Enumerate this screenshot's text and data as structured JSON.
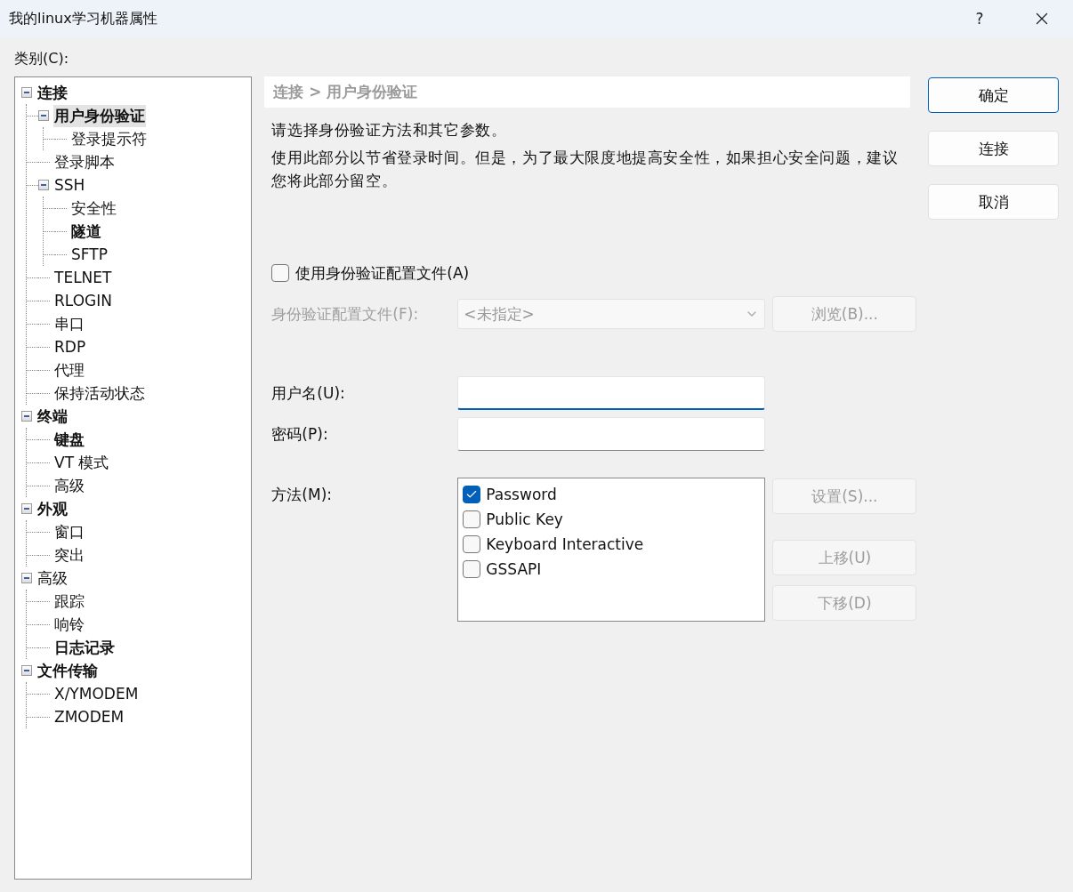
{
  "window": {
    "title": "我的linux学习机器属性",
    "help": "?"
  },
  "category_label": "类别(C):",
  "tree": [
    {
      "label": "连接",
      "bold": true,
      "selected": false,
      "expanded": true,
      "children": [
        {
          "label": "用户身份验证",
          "bold": true,
          "selected": true,
          "expanded": true,
          "children": [
            {
              "label": "登录提示符",
              "bold": false,
              "selected": false
            }
          ]
        },
        {
          "label": "登录脚本",
          "bold": false,
          "selected": false
        },
        {
          "label": "SSH",
          "bold": false,
          "selected": false,
          "expanded": true,
          "children": [
            {
              "label": "安全性",
              "bold": false,
              "selected": false
            },
            {
              "label": "隧道",
              "bold": true,
              "selected": false
            },
            {
              "label": "SFTP",
              "bold": false,
              "selected": false
            }
          ]
        },
        {
          "label": "TELNET",
          "bold": false,
          "selected": false
        },
        {
          "label": "RLOGIN",
          "bold": false,
          "selected": false
        },
        {
          "label": "串口",
          "bold": false,
          "selected": false
        },
        {
          "label": "RDP",
          "bold": false,
          "selected": false
        },
        {
          "label": "代理",
          "bold": false,
          "selected": false
        },
        {
          "label": "保持活动状态",
          "bold": false,
          "selected": false
        }
      ]
    },
    {
      "label": "终端",
      "bold": true,
      "selected": false,
      "expanded": true,
      "children": [
        {
          "label": "键盘",
          "bold": true,
          "selected": false
        },
        {
          "label": "VT 模式",
          "bold": false,
          "selected": false
        },
        {
          "label": "高级",
          "bold": false,
          "selected": false
        }
      ]
    },
    {
      "label": "外观",
      "bold": true,
      "selected": false,
      "expanded": true,
      "children": [
        {
          "label": "窗口",
          "bold": false,
          "selected": false
        },
        {
          "label": "突出",
          "bold": false,
          "selected": false
        }
      ]
    },
    {
      "label": "高级",
      "bold": false,
      "selected": false,
      "expanded": true,
      "children": [
        {
          "label": "跟踪",
          "bold": false,
          "selected": false
        },
        {
          "label": "响铃",
          "bold": false,
          "selected": false
        },
        {
          "label": "日志记录",
          "bold": true,
          "selected": false
        }
      ]
    },
    {
      "label": "文件传输",
      "bold": true,
      "selected": false,
      "expanded": true,
      "children": [
        {
          "label": "X/YMODEM",
          "bold": false,
          "selected": false
        },
        {
          "label": "ZMODEM",
          "bold": false,
          "selected": false
        }
      ]
    }
  ],
  "breadcrumb": "连接 > 用户身份验证",
  "descriptions": [
    "请选择身份验证方法和其它参数。",
    "使用此部分以节省登录时间。但是，为了最大限度地提高安全性，如果担心安全问题，建议您将此部分留空。"
  ],
  "use_profile": {
    "label": "使用身份验证配置文件(A)",
    "checked": false
  },
  "profile": {
    "label": "身份验证配置文件(F):",
    "value": "<未指定>",
    "disabled": true,
    "browse": "浏览(B)..."
  },
  "username": {
    "label": "用户名(U):",
    "focused": true
  },
  "password": {
    "label": "密码(P):",
    "focused": false
  },
  "method": {
    "label": "方法(M):",
    "items": [
      {
        "label": "Password",
        "checked": true
      },
      {
        "label": "Public Key",
        "checked": false
      },
      {
        "label": "Keyboard Interactive",
        "checked": false
      },
      {
        "label": "GSSAPI",
        "checked": false
      }
    ],
    "buttons": [
      {
        "label": "设置(S)...",
        "disabled": true
      },
      {
        "label": "上移(U)",
        "disabled": true
      },
      {
        "label": "下移(D)",
        "disabled": true
      }
    ]
  },
  "dialog_buttons": [
    {
      "label": "确定",
      "default": true
    },
    {
      "label": "连接",
      "default": false
    },
    {
      "label": "取消",
      "default": false
    }
  ]
}
